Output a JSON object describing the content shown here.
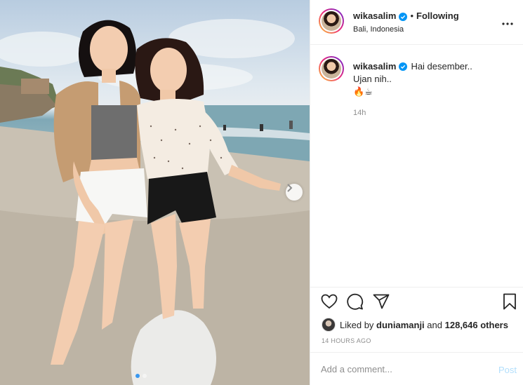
{
  "post": {
    "username": "wikasalim",
    "follow_separator": "•",
    "follow_status": "Following",
    "location": "Bali, Indonesia",
    "verified_icon": "verified-badge-icon",
    "more_icon": "more-options-icon"
  },
  "caption": {
    "username": "wikasalim",
    "text": "Hai desember..",
    "line2": "Ujan nih..",
    "emoji": "🔥☕",
    "time": "14h"
  },
  "actions": {
    "like_icon": "heart-icon",
    "comment_icon": "comment-icon",
    "share_icon": "paper-plane-icon",
    "save_icon": "bookmark-icon"
  },
  "likes": {
    "prefix": "Liked by",
    "user": "duniamanji",
    "conjunction": "and",
    "others": "128,646 others"
  },
  "timestamp": "14 HOURS AGO",
  "comment": {
    "placeholder": "Add a comment...",
    "post_label": "Post"
  },
  "colors": {
    "accent": "#0095f6",
    "post_disabled": "#b2dffc",
    "muted": "#8e8e8e",
    "text": "#262626"
  },
  "carousel": {
    "total": 2,
    "current": 1,
    "next_icon": "chevron-right-icon"
  }
}
